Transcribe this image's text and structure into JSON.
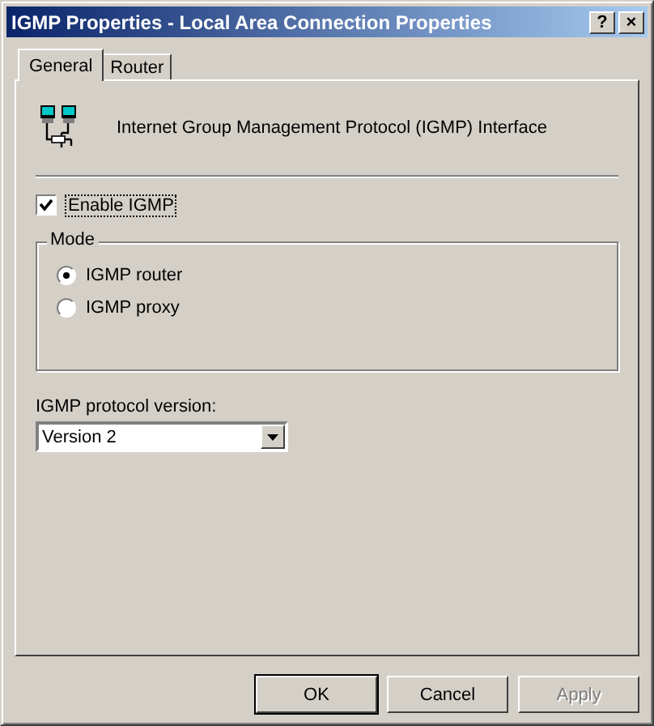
{
  "window": {
    "title": "IGMP Properties - Local Area Connection Properties",
    "title_buttons": [
      "?",
      "×"
    ]
  },
  "tabs": [
    {
      "label": "General",
      "selected": true
    },
    {
      "label": "Router",
      "selected": false
    }
  ],
  "header": {
    "text": "Internet Group Management Protocol (IGMP) Interface"
  },
  "enable_igmp": {
    "label": "Enable IGMP",
    "checked": true
  },
  "mode": {
    "title": "Mode",
    "options": [
      {
        "label": "IGMP router",
        "selected": true
      },
      {
        "label": "IGMP proxy",
        "selected": false
      }
    ]
  },
  "version": {
    "label": "IGMP protocol version:",
    "value": "Version 2"
  },
  "buttons": [
    {
      "label": "OK",
      "disabled": false,
      "default": true
    },
    {
      "label": "Cancel",
      "disabled": false,
      "default": false
    },
    {
      "label": "Apply",
      "disabled": true,
      "default": false
    }
  ]
}
